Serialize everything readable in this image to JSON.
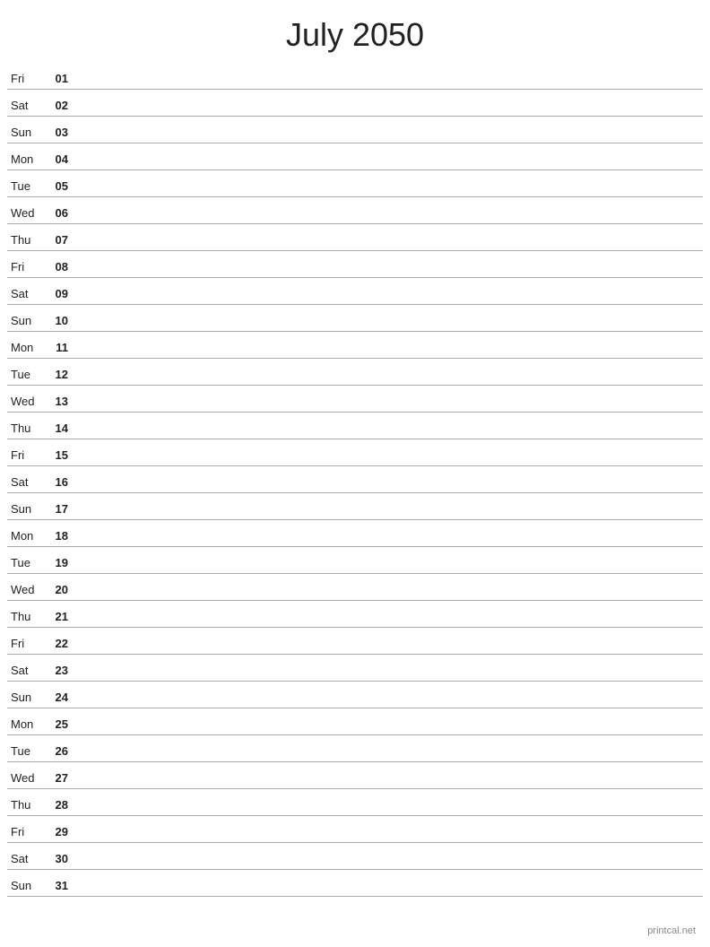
{
  "title": "July 2050",
  "footer": "printcal.net",
  "days": [
    {
      "name": "Fri",
      "num": "01"
    },
    {
      "name": "Sat",
      "num": "02"
    },
    {
      "name": "Sun",
      "num": "03"
    },
    {
      "name": "Mon",
      "num": "04"
    },
    {
      "name": "Tue",
      "num": "05"
    },
    {
      "name": "Wed",
      "num": "06"
    },
    {
      "name": "Thu",
      "num": "07"
    },
    {
      "name": "Fri",
      "num": "08"
    },
    {
      "name": "Sat",
      "num": "09"
    },
    {
      "name": "Sun",
      "num": "10"
    },
    {
      "name": "Mon",
      "num": "11"
    },
    {
      "name": "Tue",
      "num": "12"
    },
    {
      "name": "Wed",
      "num": "13"
    },
    {
      "name": "Thu",
      "num": "14"
    },
    {
      "name": "Fri",
      "num": "15"
    },
    {
      "name": "Sat",
      "num": "16"
    },
    {
      "name": "Sun",
      "num": "17"
    },
    {
      "name": "Mon",
      "num": "18"
    },
    {
      "name": "Tue",
      "num": "19"
    },
    {
      "name": "Wed",
      "num": "20"
    },
    {
      "name": "Thu",
      "num": "21"
    },
    {
      "name": "Fri",
      "num": "22"
    },
    {
      "name": "Sat",
      "num": "23"
    },
    {
      "name": "Sun",
      "num": "24"
    },
    {
      "name": "Mon",
      "num": "25"
    },
    {
      "name": "Tue",
      "num": "26"
    },
    {
      "name": "Wed",
      "num": "27"
    },
    {
      "name": "Thu",
      "num": "28"
    },
    {
      "name": "Fri",
      "num": "29"
    },
    {
      "name": "Sat",
      "num": "30"
    },
    {
      "name": "Sun",
      "num": "31"
    }
  ]
}
